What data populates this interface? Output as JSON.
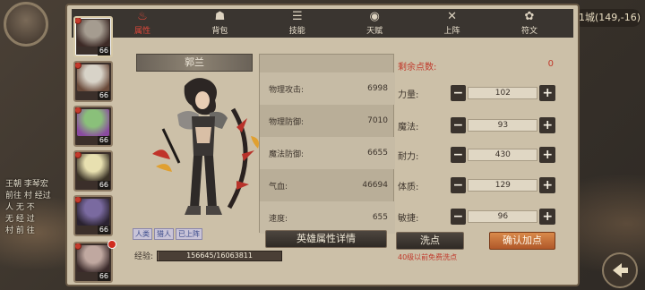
{
  "world": {
    "coord": "1城(149,-16)",
    "log": [
      "王朝 李琴宏",
      "前往 村 经过",
      "人 无 不",
      "无 经 过",
      "村 前 往"
    ]
  },
  "tabs": [
    {
      "label": "属性",
      "icon": "flame-icon",
      "glyph": "♨",
      "active": true
    },
    {
      "label": "背包",
      "icon": "backpack-icon",
      "glyph": "☗",
      "active": false
    },
    {
      "label": "技能",
      "icon": "book-icon",
      "glyph": "☰",
      "active": false
    },
    {
      "label": "天赋",
      "icon": "eye-icon",
      "glyph": "◉",
      "active": false
    },
    {
      "label": "上阵",
      "icon": "crossed-swords-icon",
      "glyph": "✕",
      "active": false
    },
    {
      "label": "符文",
      "icon": "rune-icon",
      "glyph": "✿",
      "active": false
    }
  ],
  "roster": [
    {
      "level": "66",
      "colors": [
        "#a59c90",
        "#3d2a26"
      ]
    },
    {
      "level": "66",
      "colors": [
        "#d8d3c8",
        "#6a4a3a"
      ]
    },
    {
      "level": "66",
      "colors": [
        "#8ac07a",
        "#8a4aa0"
      ]
    },
    {
      "level": "66",
      "colors": [
        "#e8e0b0",
        "#3a3226"
      ]
    },
    {
      "level": "66",
      "colors": [
        "#7a6aa0",
        "#2a2230"
      ]
    },
    {
      "level": "66",
      "colors": [
        "#c0a8a0",
        "#3a2a2a"
      ]
    }
  ],
  "hero": {
    "name": "郭兰",
    "tags": [
      "人类",
      "猎人",
      "已上阵"
    ],
    "exp_label": "经验:",
    "exp_text": "156645/16063811",
    "exp_fraction": 0.0098
  },
  "stats": [
    {
      "label": "物理攻击:",
      "value": "6998"
    },
    {
      "label": "物理防御:",
      "value": "7010"
    },
    {
      "label": "魔法防御:",
      "value": "6655"
    },
    {
      "label": "气血:",
      "value": "46694"
    },
    {
      "label": "速度:",
      "value": "655"
    }
  ],
  "detail_button": "英雄属性详情",
  "alloc": {
    "remaining_label": "剩余点数:",
    "remaining_value": "0",
    "rows": [
      {
        "label": "力量:",
        "value": "102"
      },
      {
        "label": "魔法:",
        "value": "93"
      },
      {
        "label": "耐力:",
        "value": "430"
      },
      {
        "label": "体质:",
        "value": "129"
      },
      {
        "label": "敏捷:",
        "value": "96"
      }
    ],
    "minus": "−",
    "plus": "+"
  },
  "wash_button": "洗点",
  "confirm_button": "确认加点",
  "wash_note": "40级以前免费洗点",
  "colors": {
    "panel": "#ccc0a8",
    "tab_bar": "#3a3530",
    "active_tab": "#e0483a",
    "accent_red": "#c0392b",
    "confirm": "#c8703a"
  }
}
